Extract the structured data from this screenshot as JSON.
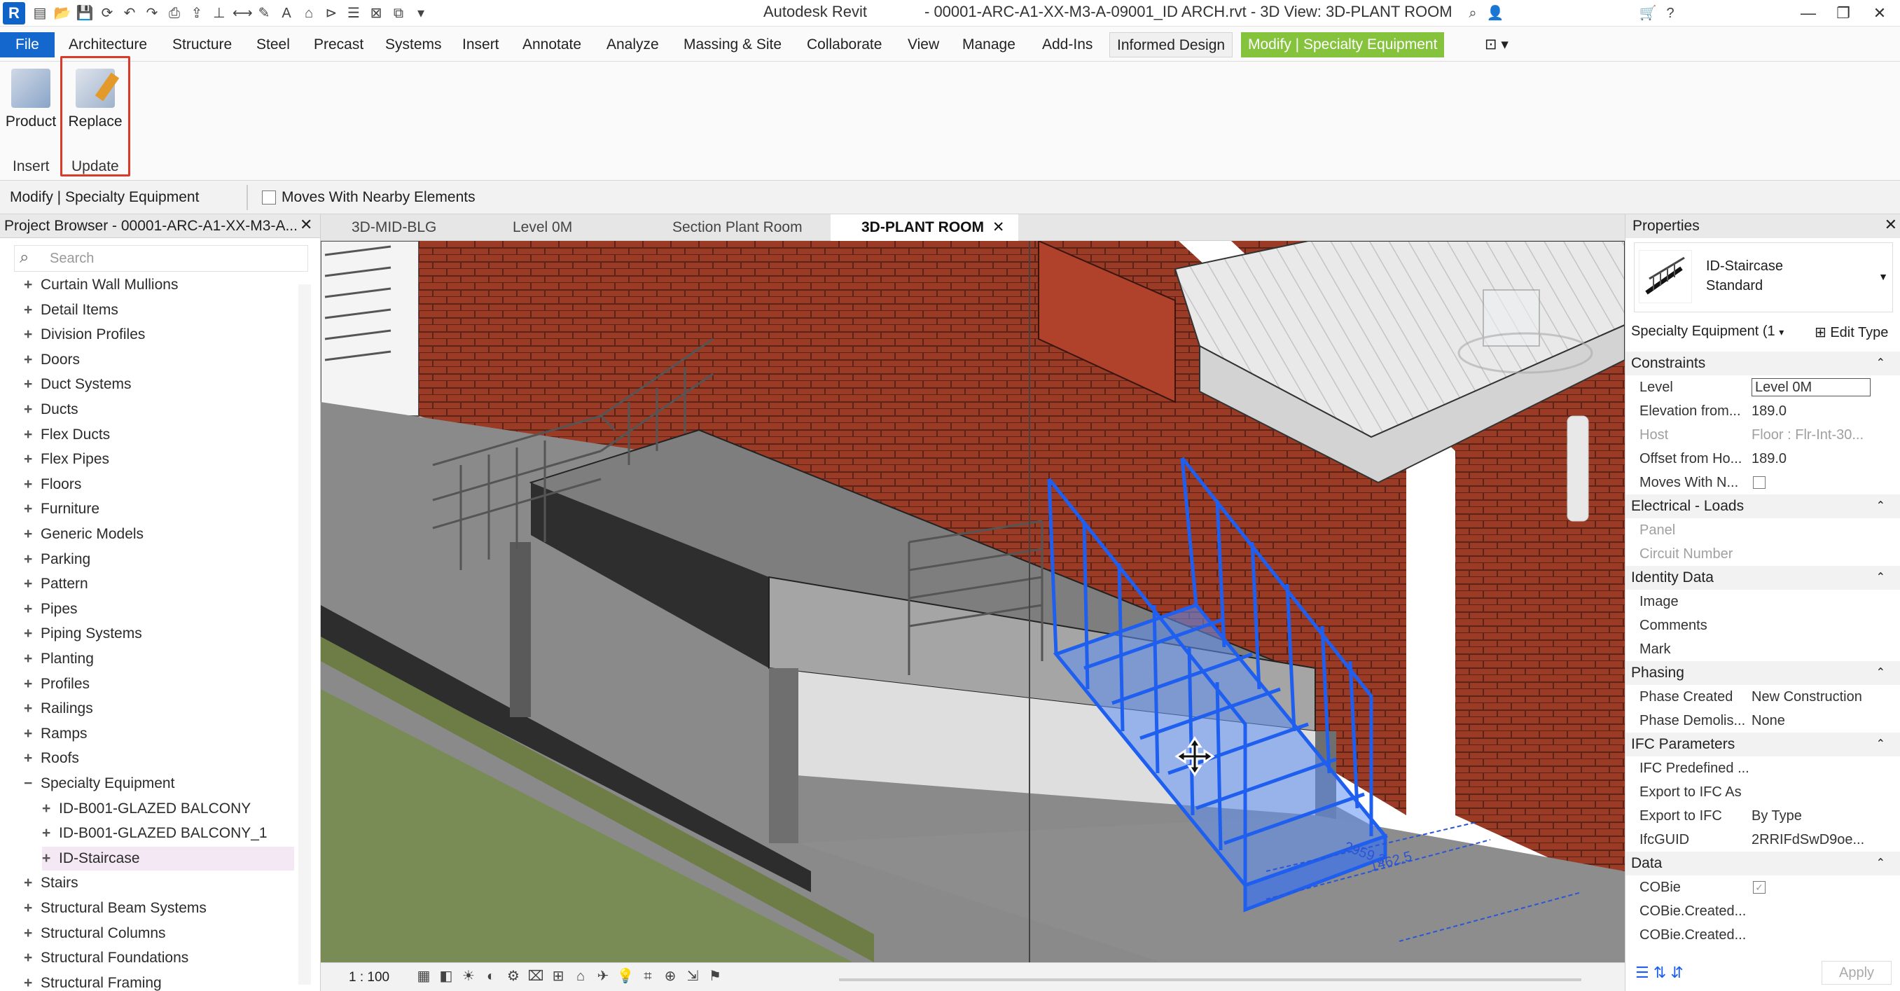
{
  "titlebar": {
    "app_name": "Autodesk Revit",
    "file_title": "- 00001-ARC-A1-XX-M3-A-09001_ID ARCH.rvt - 3D View: 3D-PLANT ROOM"
  },
  "ribbon_tabs": [
    "File",
    "Architecture",
    "Structure",
    "Steel",
    "Precast",
    "Systems",
    "Insert",
    "Annotate",
    "Analyze",
    "Massing & Site",
    "Collaborate",
    "View",
    "Manage",
    "Add-Ins",
    "Informed Design",
    "Modify | Specialty Equipment"
  ],
  "ribbon": {
    "buttons": [
      {
        "label": "Product",
        "icon": "product-icon"
      },
      {
        "label": "Replace",
        "icon": "replace-icon"
      }
    ],
    "panels": [
      "Insert",
      "Update"
    ]
  },
  "option_bar": {
    "context": "Modify | Specialty Equipment",
    "checkbox_label": "Moves With Nearby Elements"
  },
  "project_browser": {
    "title": "Project Browser - 00001-ARC-A1-XX-M3-A...",
    "search_placeholder": "Search",
    "items": [
      {
        "label": "Curtain Wall Mullions",
        "indent": 0,
        "sign": "+"
      },
      {
        "label": "Detail Items",
        "indent": 0,
        "sign": "+"
      },
      {
        "label": "Division Profiles",
        "indent": 0,
        "sign": "+"
      },
      {
        "label": "Doors",
        "indent": 0,
        "sign": "+"
      },
      {
        "label": "Duct Systems",
        "indent": 0,
        "sign": "+"
      },
      {
        "label": "Ducts",
        "indent": 0,
        "sign": "+"
      },
      {
        "label": "Flex Ducts",
        "indent": 0,
        "sign": "+"
      },
      {
        "label": "Flex Pipes",
        "indent": 0,
        "sign": "+"
      },
      {
        "label": "Floors",
        "indent": 0,
        "sign": "+"
      },
      {
        "label": "Furniture",
        "indent": 0,
        "sign": "+"
      },
      {
        "label": "Generic Models",
        "indent": 0,
        "sign": "+"
      },
      {
        "label": "Parking",
        "indent": 0,
        "sign": "+"
      },
      {
        "label": "Pattern",
        "indent": 0,
        "sign": "+"
      },
      {
        "label": "Pipes",
        "indent": 0,
        "sign": "+"
      },
      {
        "label": "Piping Systems",
        "indent": 0,
        "sign": "+"
      },
      {
        "label": "Planting",
        "indent": 0,
        "sign": "+"
      },
      {
        "label": "Profiles",
        "indent": 0,
        "sign": "+"
      },
      {
        "label": "Railings",
        "indent": 0,
        "sign": "+"
      },
      {
        "label": "Ramps",
        "indent": 0,
        "sign": "+"
      },
      {
        "label": "Roofs",
        "indent": 0,
        "sign": "+"
      },
      {
        "label": "Specialty Equipment",
        "indent": 0,
        "sign": "−"
      },
      {
        "label": "ID-B001-GLAZED BALCONY",
        "indent": 1,
        "sign": "+"
      },
      {
        "label": "ID-B001-GLAZED BALCONY_1",
        "indent": 1,
        "sign": "+"
      },
      {
        "label": "ID-Staircase",
        "indent": 1,
        "sign": "+",
        "selected": true
      },
      {
        "label": "Stairs",
        "indent": 0,
        "sign": "+"
      },
      {
        "label": "Structural Beam Systems",
        "indent": 0,
        "sign": "+"
      },
      {
        "label": "Structural Columns",
        "indent": 0,
        "sign": "+"
      },
      {
        "label": "Structural Foundations",
        "indent": 0,
        "sign": "+"
      },
      {
        "label": "Structural Framing",
        "indent": 0,
        "sign": "+"
      }
    ]
  },
  "view_tabs": [
    {
      "label": "3D-MID-BLG",
      "active": false
    },
    {
      "label": "Level 0M",
      "active": false
    },
    {
      "label": "Section Plant Room",
      "active": false
    },
    {
      "label": "3D-PLANT ROOM",
      "active": true
    }
  ],
  "view_bar": {
    "scale": "1 : 100"
  },
  "viewport": {
    "dimension_1": "2959.3",
    "dimension_2": "1462.5",
    "highlight_color": "#1f5ff0"
  },
  "properties": {
    "title": "Properties",
    "type_name": "ID-Staircase",
    "type_sub": "Standard",
    "selector": "Specialty Equipment (1",
    "edit_type": "Edit Type",
    "apply": "Apply",
    "groups": [
      {
        "name": "Constraints",
        "rows": [
          {
            "k": "Level",
            "v": "Level 0M",
            "grey": false,
            "boxed": true
          },
          {
            "k": "Elevation from...",
            "v": "189.0",
            "grey": false
          },
          {
            "k": "Host",
            "v": "Floor : Flr-Int-30...",
            "grey": true
          },
          {
            "k": "Offset from Ho...",
            "v": "189.0",
            "grey": false
          },
          {
            "k": "Moves With N...",
            "v": "",
            "grey": false,
            "checkbox": true
          }
        ]
      },
      {
        "name": "Electrical - Loads",
        "rows": [
          {
            "k": "Panel",
            "v": "",
            "grey": true
          },
          {
            "k": "Circuit Number",
            "v": "",
            "grey": true
          }
        ]
      },
      {
        "name": "Identity Data",
        "rows": [
          {
            "k": "Image",
            "v": "",
            "grey": false
          },
          {
            "k": "Comments",
            "v": "",
            "grey": false
          },
          {
            "k": "Mark",
            "v": "",
            "grey": false
          }
        ]
      },
      {
        "name": "Phasing",
        "rows": [
          {
            "k": "Phase Created",
            "v": "New Construction",
            "grey": false
          },
          {
            "k": "Phase Demolis...",
            "v": "None",
            "grey": false
          }
        ]
      },
      {
        "name": "IFC Parameters",
        "rows": [
          {
            "k": "IFC Predefined ...",
            "v": "",
            "grey": false
          },
          {
            "k": "Export to IFC As",
            "v": "",
            "grey": false
          },
          {
            "k": "Export to IFC",
            "v": "By Type",
            "grey": false
          },
          {
            "k": "IfcGUID",
            "v": "2RRIFdSwD9oe...",
            "grey": false
          }
        ]
      },
      {
        "name": "Data",
        "rows": [
          {
            "k": "COBie",
            "v": "",
            "grey": false,
            "checkbox": true,
            "checked": true
          },
          {
            "k": "COBie.Created...",
            "v": "",
            "grey": false
          },
          {
            "k": "COBie.Created...",
            "v": "",
            "grey": false
          }
        ]
      }
    ]
  }
}
